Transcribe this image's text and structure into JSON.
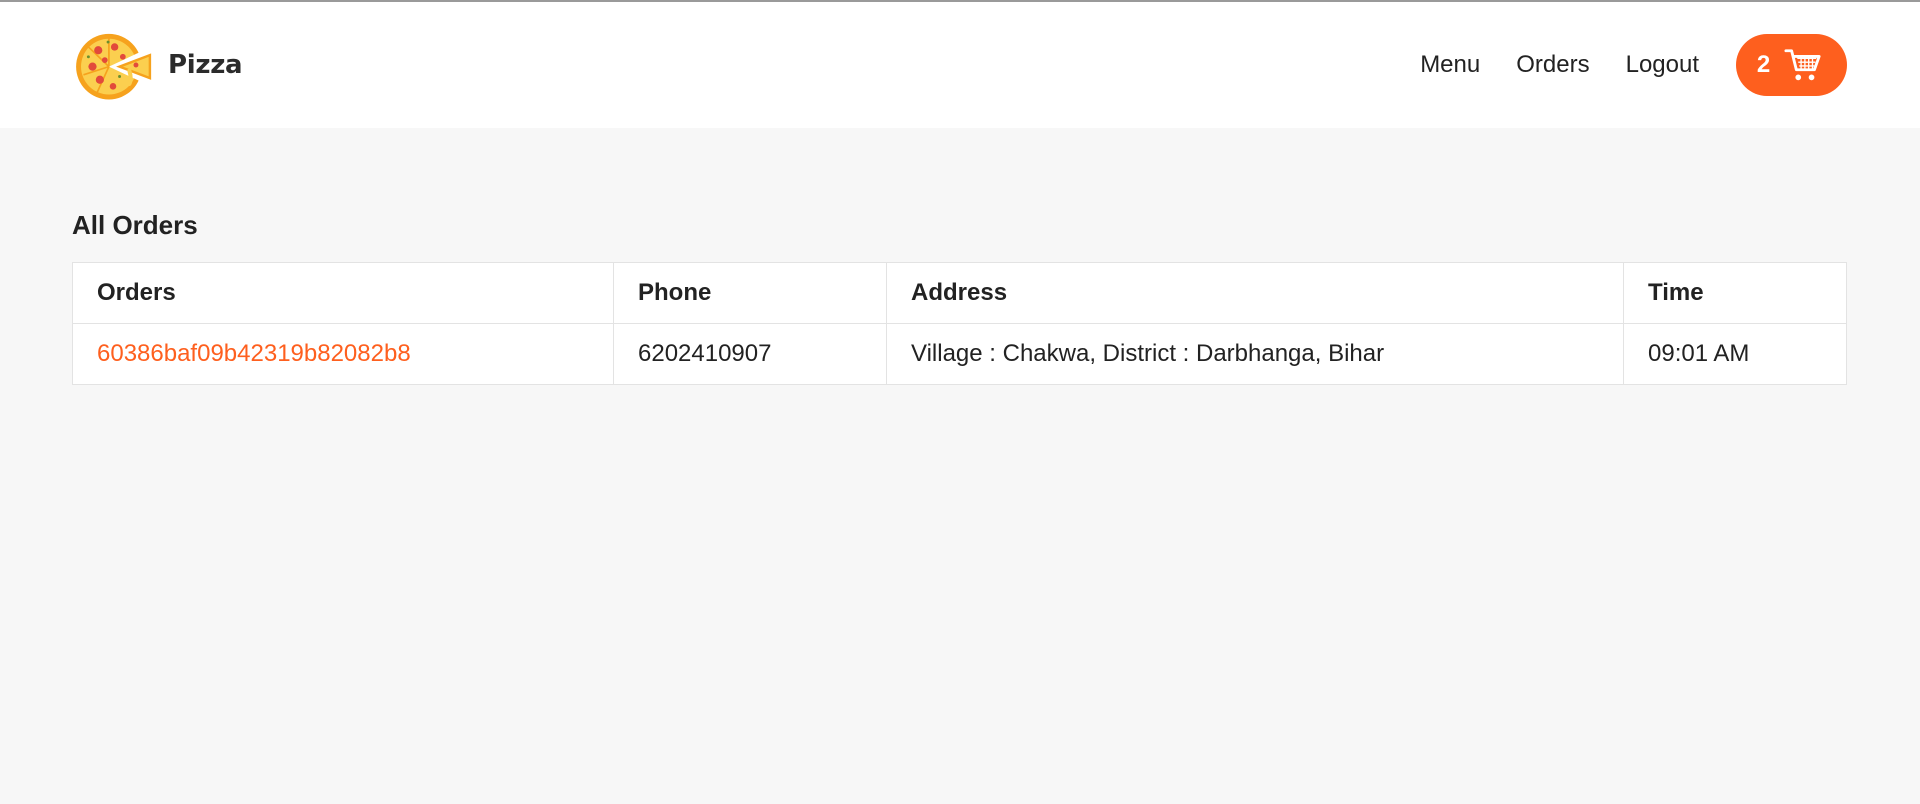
{
  "brand": {
    "name": "Pizza",
    "logo_icon": "pizza-icon"
  },
  "nav": {
    "links": [
      {
        "label": "Menu"
      },
      {
        "label": "Orders"
      },
      {
        "label": "Logout"
      }
    ],
    "cart": {
      "count": "2",
      "icon": "cart-icon"
    }
  },
  "page": {
    "title": "All Orders"
  },
  "table": {
    "headers": [
      "Orders",
      "Phone",
      "Address",
      "Time"
    ],
    "rows": [
      {
        "order_id": "60386baf09b42319b82082b8",
        "phone": "6202410907",
        "address": "Village : Chakwa, District : Darbhanga, Bihar",
        "time": "09:01 AM"
      }
    ]
  },
  "colors": {
    "accent": "#fe5f1e",
    "background": "#f7f7f7",
    "surface": "#ffffff"
  }
}
